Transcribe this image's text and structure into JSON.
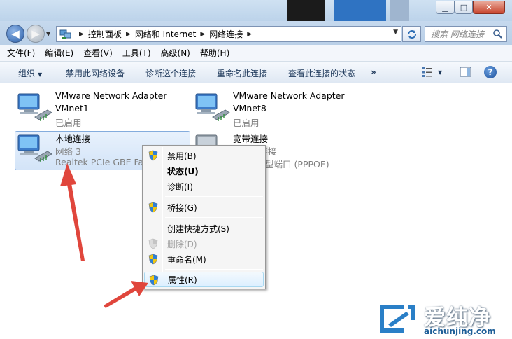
{
  "window": {
    "controls": {
      "minimize": "▁",
      "maximize": "□",
      "close": "✕"
    }
  },
  "address_bar": {
    "back_glyph": "◀",
    "forward_glyph": "▶",
    "breadcrumbs": [
      "控制面板",
      "网络和 Internet",
      "网络连接"
    ],
    "search_placeholder": "搜索 网络连接"
  },
  "menu": [
    "文件(F)",
    "编辑(E)",
    "查看(V)",
    "工具(T)",
    "高级(N)",
    "帮助(H)"
  ],
  "toolbar": {
    "organize": "组织",
    "disable": "禁用此网络设备",
    "diagnose": "诊断这个连接",
    "rename": "重命名此连接",
    "status": "查看此连接的状态",
    "more": "»",
    "help": "?"
  },
  "adapters": [
    {
      "name": "VMware Network Adapter",
      "line2": "VMnet1",
      "line3": "已启用"
    },
    {
      "name": "VMware Network Adapter",
      "line2": "VMnet8",
      "line3": "已启用"
    },
    {
      "name": "本地连接",
      "line2": "网络  3",
      "line3": "Realtek PCIe GBE Fam"
    },
    {
      "name": "宽带连接",
      "line2": "已断开连接",
      "line3": "WAN 微型端口 (PPPOE)"
    }
  ],
  "context_menu": {
    "disable": "禁用(B)",
    "status": "状态(U)",
    "diagnose": "诊断(I)",
    "bridge": "桥接(G)",
    "shortcut": "创建快捷方式(S)",
    "delete": "删除(D)",
    "rename": "重命名(M)",
    "properties": "属性(R)"
  },
  "watermark": {
    "brand": "爱纯净",
    "url": "aichunjing.com"
  },
  "colors": {
    "arrow": "#e0463c",
    "selection": "#d3e4f8"
  }
}
